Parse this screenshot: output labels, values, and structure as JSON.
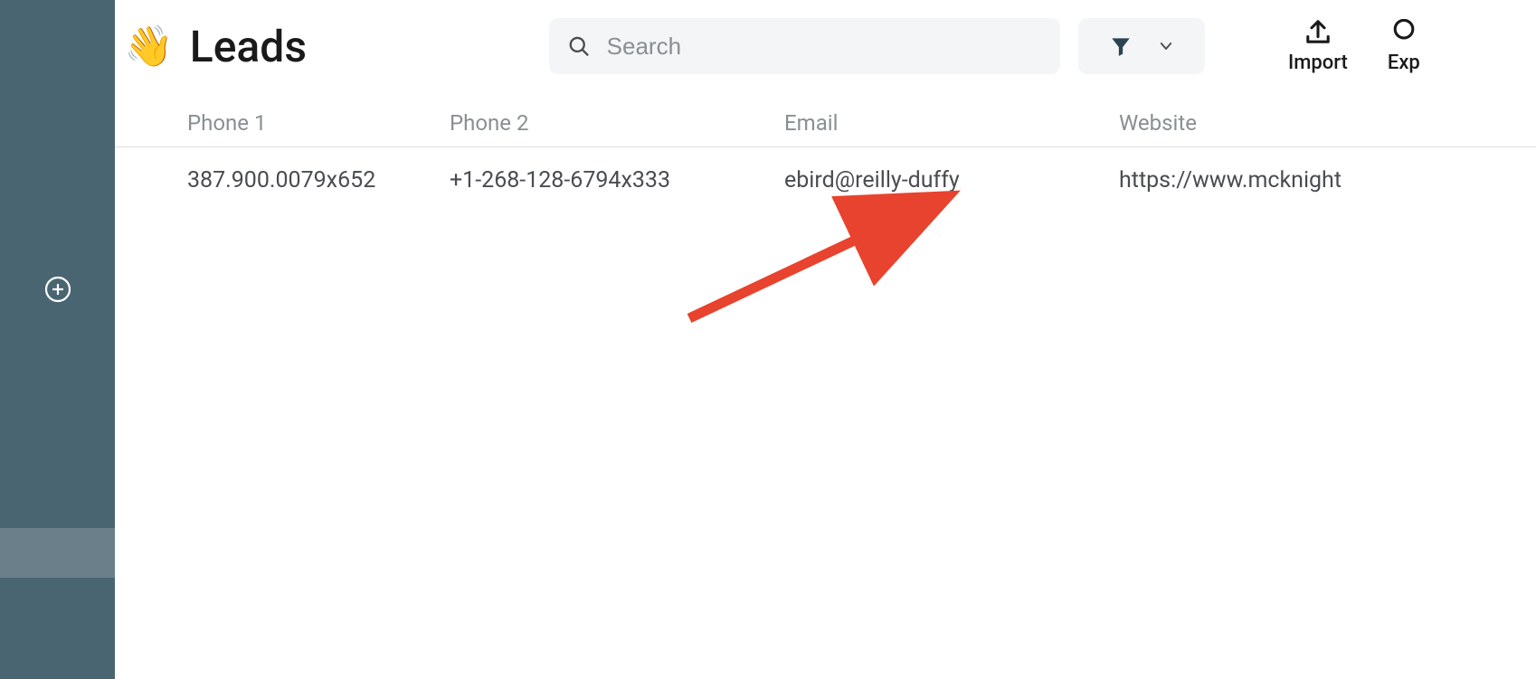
{
  "header": {
    "emoji": "👋",
    "title": "Leads",
    "search_placeholder": "Search",
    "import_label": "Import",
    "export_label": "Exp"
  },
  "table": {
    "columns": [
      "Phone 1",
      "Phone 2",
      "Email",
      "Website"
    ],
    "rows": [
      {
        "phone1": "387.900.0079x652",
        "phone2": "+1-268-128-6794x333",
        "email": "ebird@reilly-duffy",
        "website": "https://www.mcknight"
      }
    ]
  }
}
